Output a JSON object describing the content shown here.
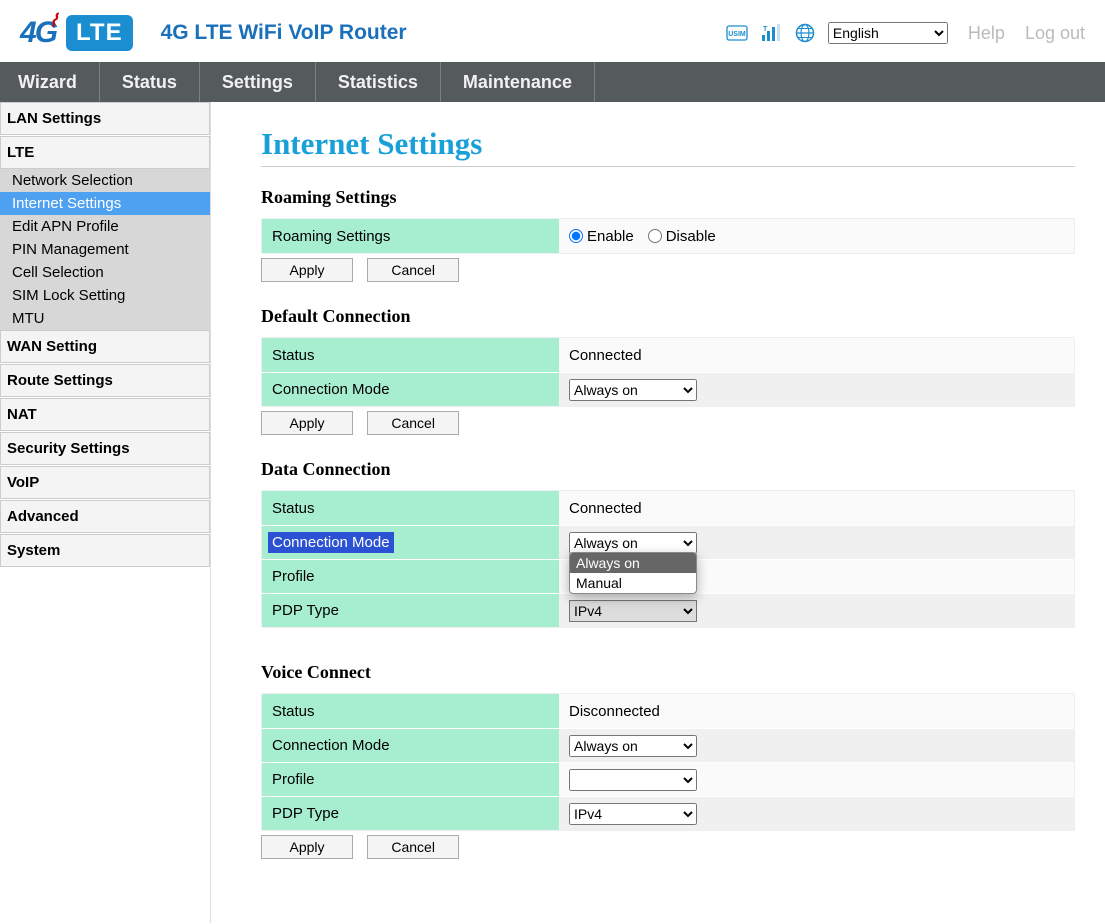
{
  "header": {
    "product_title": "4G LTE WiFi VoIP Router",
    "lang_selected": "English",
    "help": "Help",
    "logout": "Log out"
  },
  "topnav": [
    "Wizard",
    "Status",
    "Settings",
    "Statistics",
    "Maintenance"
  ],
  "sidebar": {
    "groups_before": [
      "LAN Settings"
    ],
    "active_group": "LTE",
    "active_items": [
      "Network Selection",
      "Internet Settings",
      "Edit APN Profile",
      "PIN Management",
      "Cell Selection",
      "SIM Lock Setting",
      "MTU"
    ],
    "active_selected_index": 1,
    "groups_after": [
      "WAN Setting",
      "Route Settings",
      "NAT",
      "Security Settings",
      "VoIP",
      "Advanced",
      "System"
    ]
  },
  "page_title": "Internet Settings",
  "buttons": {
    "apply": "Apply",
    "cancel": "Cancel"
  },
  "roaming": {
    "section_title": "Roaming Settings",
    "label": "Roaming Settings",
    "enable": "Enable",
    "disable": "Disable",
    "value": "Enable"
  },
  "default_conn": {
    "section_title": "Default Connection",
    "status_label": "Status",
    "status_value": "Connected",
    "mode_label": "Connection Mode",
    "mode_value": "Always on"
  },
  "data_conn": {
    "section_title": "Data Connection",
    "status_label": "Status",
    "status_value": "Connected",
    "mode_label": "Connection Mode",
    "mode_value": "Always on",
    "mode_options": [
      "Always on",
      "Manual"
    ],
    "mode_selected_index": 0,
    "profile_label": "Profile",
    "profile_value": "",
    "pdp_label": "PDP Type",
    "pdp_value": "IPv4"
  },
  "voice_conn": {
    "section_title": "Voice Connect",
    "status_label": "Status",
    "status_value": "Disconnected",
    "mode_label": "Connection Mode",
    "mode_value": "Always on",
    "profile_label": "Profile",
    "profile_value": "",
    "pdp_label": "PDP Type",
    "pdp_value": "IPv4"
  }
}
